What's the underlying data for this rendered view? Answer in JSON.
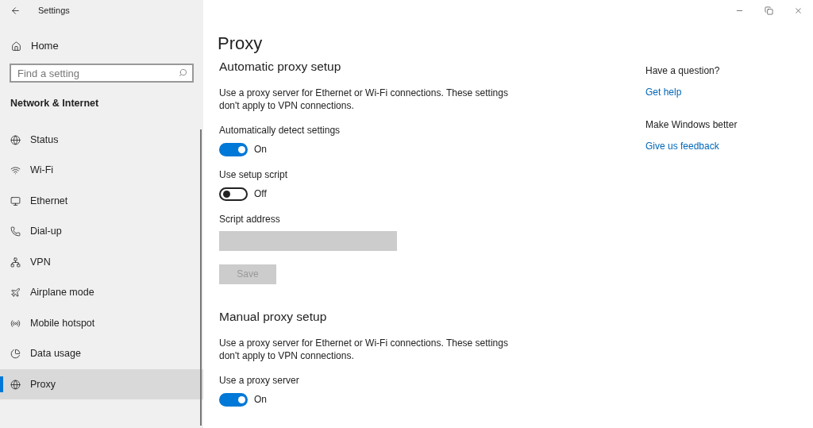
{
  "window": {
    "title": "Settings"
  },
  "sidebar": {
    "home": "Home",
    "search": {
      "placeholder": "Find a setting"
    },
    "category": "Network & Internet",
    "items": [
      {
        "label": "Status",
        "selected": false
      },
      {
        "label": "Wi-Fi",
        "selected": false
      },
      {
        "label": "Ethernet",
        "selected": false
      },
      {
        "label": "Dial-up",
        "selected": false
      },
      {
        "label": "VPN",
        "selected": false
      },
      {
        "label": "Airplane mode",
        "selected": false
      },
      {
        "label": "Mobile hotspot",
        "selected": false
      },
      {
        "label": "Data usage",
        "selected": false
      },
      {
        "label": "Proxy",
        "selected": true
      }
    ]
  },
  "page_title": "Proxy",
  "sections": [
    {
      "heading": "Automatic proxy setup",
      "description": "Use a proxy server for Ethernet or Wi-Fi connections. These settings don't apply to VPN connections.",
      "controls": [
        {
          "kind": "toggle",
          "label": "Automatically detect settings",
          "on": true,
          "state_text": "On"
        },
        {
          "kind": "toggle",
          "label": "Use setup script",
          "on": false,
          "state_text": "Off"
        },
        {
          "kind": "field",
          "label": "Script address",
          "disabled": true
        },
        {
          "kind": "button",
          "label": "Save",
          "disabled": true
        }
      ]
    },
    {
      "heading": "Manual proxy setup",
      "description": "Use a proxy server for Ethernet or Wi-Fi connections. These settings don't apply to VPN connections.",
      "controls": [
        {
          "kind": "toggle",
          "label": "Use a proxy server",
          "on": true,
          "state_text": "On"
        }
      ]
    }
  ],
  "aside": [
    {
      "heading": "Have a question?",
      "link": "Get help"
    },
    {
      "heading": "Make Windows better",
      "link": "Give us feedback"
    }
  ]
}
